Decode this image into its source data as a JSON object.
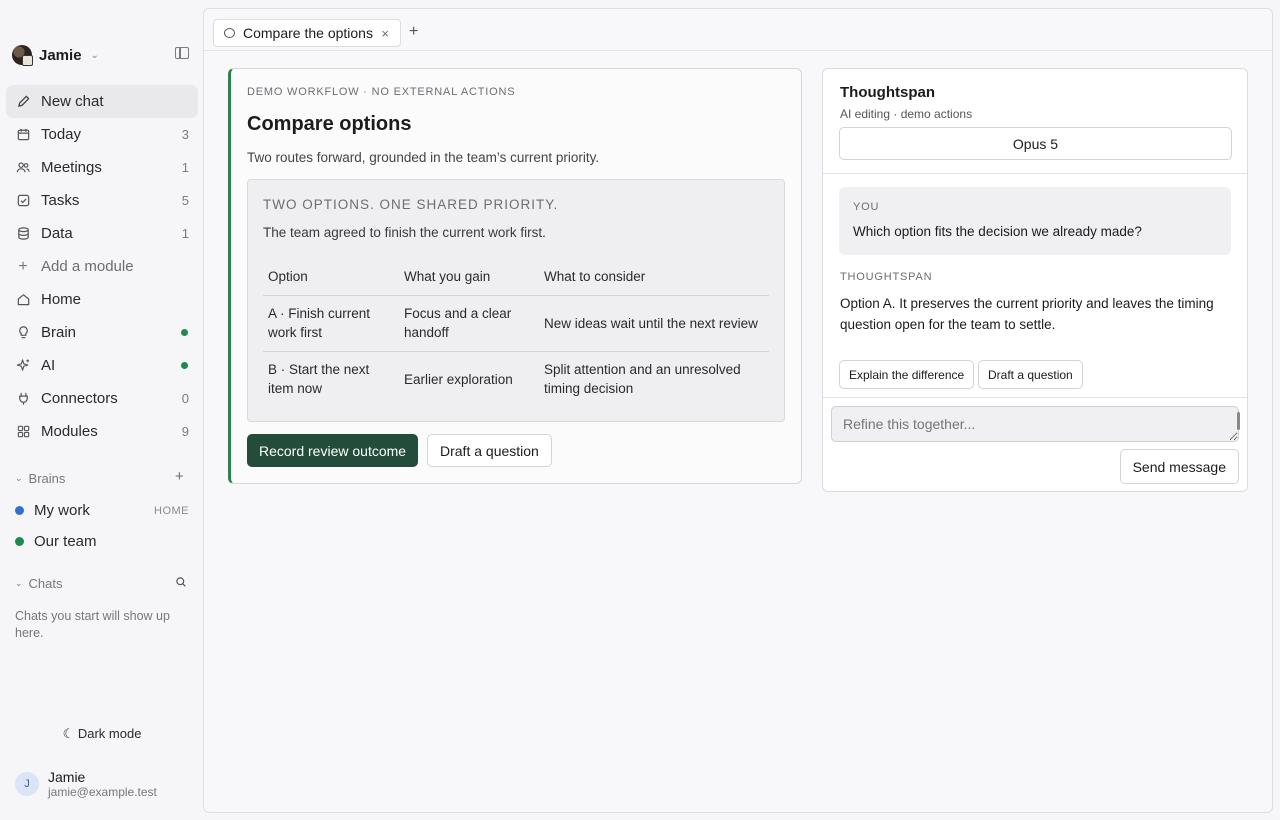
{
  "account": {
    "name": "Jamie"
  },
  "nav": [
    {
      "label": "New chat",
      "icon": "pencil-icon",
      "count": ""
    },
    {
      "label": "Today",
      "icon": "calendar-icon",
      "count": "3"
    },
    {
      "label": "Meetings",
      "icon": "people-icon",
      "count": "1"
    },
    {
      "label": "Tasks",
      "icon": "checkbox-icon",
      "count": "5"
    },
    {
      "label": "Data",
      "icon": "database-icon",
      "count": "1"
    },
    {
      "label": "Add a module",
      "icon": "plus-icon",
      "count": ""
    },
    {
      "label": "Home",
      "icon": "home-icon",
      "count": ""
    },
    {
      "label": "Brain",
      "icon": "lightbulb-icon",
      "count": ""
    },
    {
      "label": "AI",
      "icon": "sparkle-icon",
      "count": ""
    },
    {
      "label": "Connectors",
      "icon": "plug-icon",
      "count": "0"
    },
    {
      "label": "Modules",
      "icon": "grid-icon",
      "count": "9"
    }
  ],
  "brains": {
    "header": "Brains",
    "items": [
      {
        "label": "My work",
        "tag": "HOME",
        "color": "#2f6fd0"
      },
      {
        "label": "Our team",
        "tag": "",
        "color": "#1f8a4c"
      }
    ]
  },
  "chats": {
    "header": "Chats",
    "empty": "Chats you start will show up here."
  },
  "dark_mode": "Dark mode",
  "user": {
    "initial": "J",
    "name": "Jamie",
    "email": "jamie@example.test"
  },
  "tabs": [
    {
      "label": "Compare the options"
    }
  ],
  "card": {
    "eyebrow": "DEMO WORKFLOW · NO EXTERNAL ACTIONS",
    "title": "Compare options",
    "subtitle": "Two routes forward, grounded in the team’s current priority.",
    "inner_heading": "TWO OPTIONS. ONE SHARED PRIORITY.",
    "inner_text": "The team agreed to finish the current work first.",
    "table": {
      "headers": [
        "Option",
        "What you gain",
        "What to consider"
      ],
      "rows": [
        [
          "A · Finish current work first",
          "Focus and a clear handoff",
          "New ideas wait until the next review"
        ],
        [
          "B · Start the next item now",
          "Earlier exploration",
          "Split attention and an unresolved timing decision"
        ]
      ]
    },
    "primary_button": "Record review outcome",
    "secondary_button": "Draft a question",
    "accent": "#1f8a4c"
  },
  "assistant": {
    "title": "Thoughtspan",
    "subtitle": "AI editing · demo actions",
    "model": "Opus 5",
    "you_label": "YOU",
    "you_message": "Which option fits the decision we already made?",
    "reply_label": "THOUGHTSPAN",
    "reply_message": "Option A. It preserves the current priority and leaves the timing question open for the team to settle.",
    "chips": [
      "Explain the difference",
      "Draft a question"
    ],
    "input_placeholder": "Refine this together...",
    "send_label": "Send message"
  }
}
